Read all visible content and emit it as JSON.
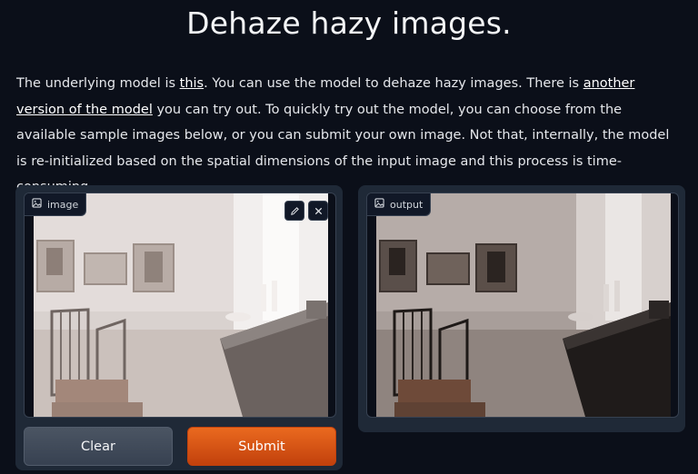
{
  "page": {
    "title": "Dehaze hazy images."
  },
  "description": {
    "part1": "The underlying model is ",
    "link1": "this",
    "part2": ". You can use the model to dehaze hazy images. There is ",
    "link2": "another version of the model",
    "part3": " you can try out. To quickly try out the model, you can choose from the available sample images below, or you can submit your own image. Not that, internally, the model is re-initialized based on the spatial dimensions of the input image and this process is time-consuming."
  },
  "input_panel": {
    "label": "image",
    "icon": "image-icon",
    "tools": [
      "edit-icon",
      "close-icon"
    ]
  },
  "output_panel": {
    "label": "output",
    "icon": "image-icon"
  },
  "buttons": {
    "clear": "Clear",
    "submit": "Submit"
  },
  "colors": {
    "background": "#0b0f19",
    "panel": "#1f2937",
    "accent": "#ea580c"
  }
}
